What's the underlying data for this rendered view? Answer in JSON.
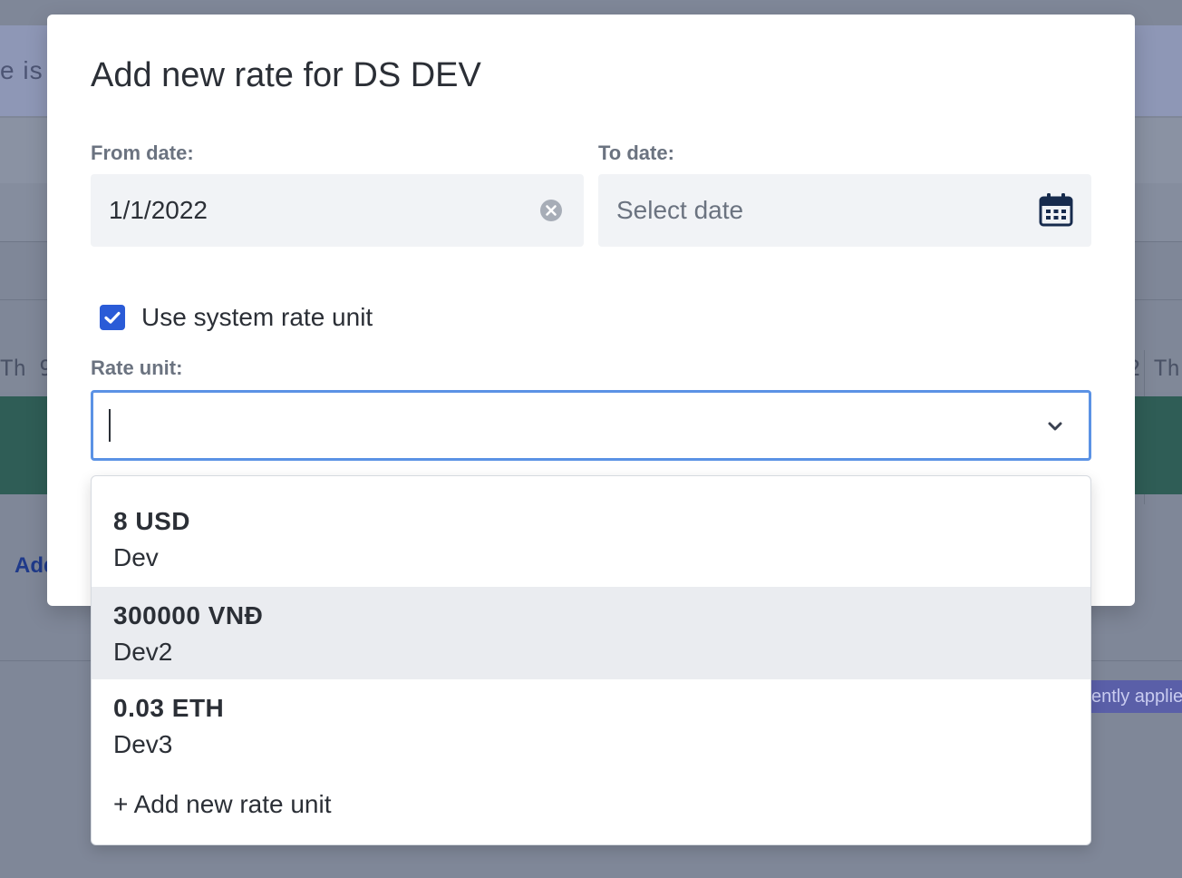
{
  "background": {
    "banner_text": "e is t",
    "day_left": "Th 9",
    "day_right": "2 Th",
    "link_text": "Add",
    "badge_text": "ently applie"
  },
  "modal": {
    "title": "Add new rate for DS DEV",
    "from_date": {
      "label": "From date:",
      "value": "1/1/2022"
    },
    "to_date": {
      "label": "To date:",
      "placeholder": "Select date"
    },
    "use_system_rate": {
      "label": "Use system rate unit",
      "checked": true
    },
    "rate_unit": {
      "label": "Rate unit:",
      "value": ""
    }
  },
  "dropdown": {
    "options": [
      {
        "rate": "8 USD",
        "name": "Dev"
      },
      {
        "rate": "300000 VNĐ",
        "name": "Dev2"
      },
      {
        "rate": "0.03 ETH",
        "name": "Dev3"
      }
    ],
    "add_new_label": "+ Add new rate unit"
  },
  "colors": {
    "accent": "#2a5bd7",
    "focus_border": "#5b92e5",
    "highlight": "#eaecf0"
  },
  "icons": {
    "clear": "clear-circle-icon",
    "calendar": "calendar-icon",
    "chevron": "chevron-down-icon",
    "check": "checkmark-icon"
  }
}
